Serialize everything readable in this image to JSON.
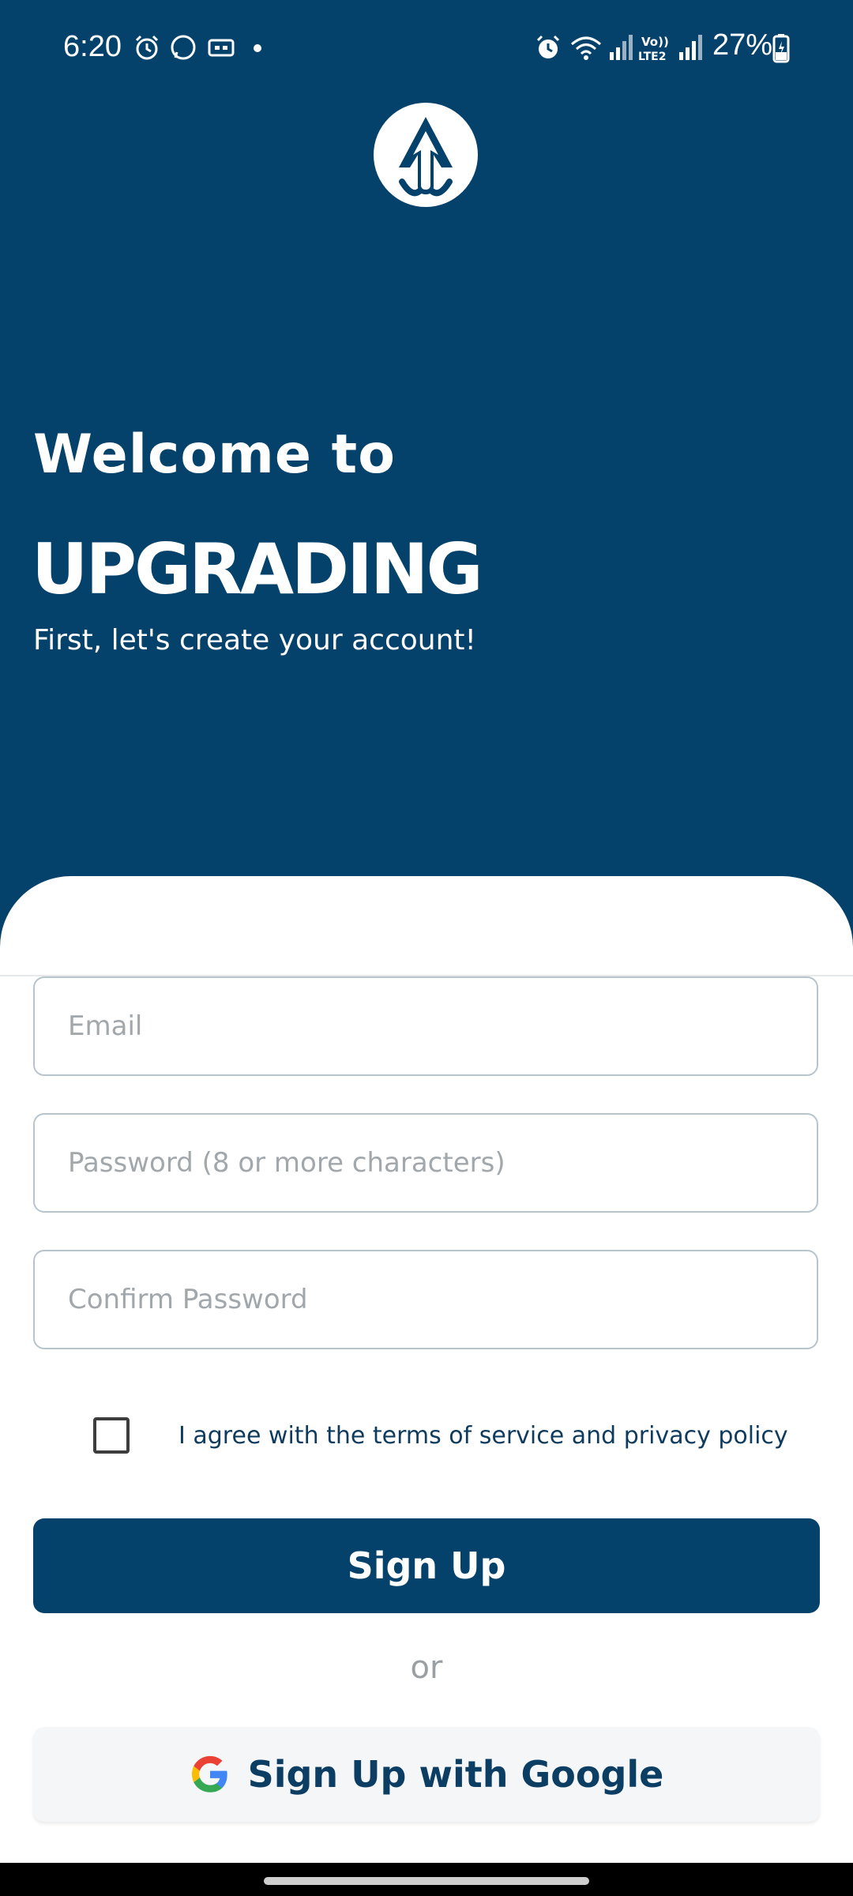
{
  "status_bar": {
    "time": "6:20",
    "battery": "27%"
  },
  "hero": {
    "welcome": "Welcome to",
    "brand": "UPGRADING",
    "subtitle": "First, let's create your account!"
  },
  "form": {
    "email_placeholder": "Email",
    "password_placeholder": "Password (8 or more characters)",
    "confirm_placeholder": "Confirm Password",
    "agree_label": "I agree with the terms of service and privacy policy",
    "agree_checked": false,
    "signup_label": "Sign Up",
    "or_label": "or",
    "google_label": "Sign Up with Google"
  },
  "colors": {
    "brand": "#04426b",
    "text_dark": "#0c3d63",
    "placeholder": "#a2a7ab"
  },
  "icons": [
    "alarm-icon",
    "whatsapp-icon",
    "notification-icon",
    "wifi-icon",
    "signal-icon",
    "battery-icon",
    "logo-arrow-icon",
    "google-icon"
  ]
}
